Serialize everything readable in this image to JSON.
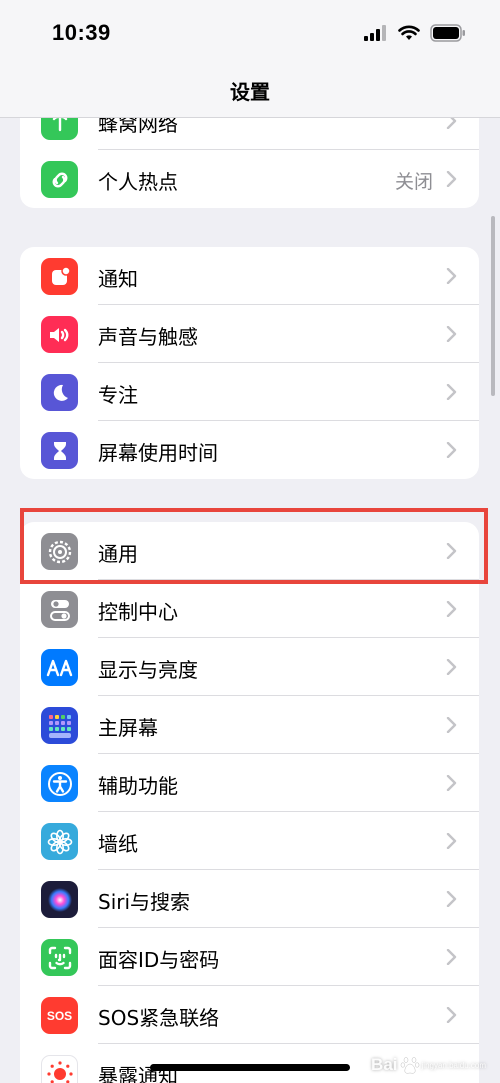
{
  "status_bar": {
    "time": "10:39"
  },
  "nav": {
    "title": "设置"
  },
  "groups": [
    {
      "items": [
        {
          "label": "蜂窝网络",
          "icon": "cellular-icon",
          "color": "#34c759"
        },
        {
          "label": "个人热点",
          "value": "关闭",
          "icon": "hotspot-icon",
          "color": "#34c759"
        }
      ]
    },
    {
      "items": [
        {
          "label": "通知",
          "icon": "notifications-icon",
          "color": "#ff3b30"
        },
        {
          "label": "声音与触感",
          "icon": "sounds-icon",
          "color": "#ff2d55"
        },
        {
          "label": "专注",
          "icon": "focus-moon-icon",
          "color": "#5856d6"
        },
        {
          "label": "屏幕使用时间",
          "icon": "hourglass-icon",
          "color": "#5856d6"
        }
      ]
    },
    {
      "items": [
        {
          "label": "通用",
          "icon": "gear-icon",
          "color": "#8e8e93"
        },
        {
          "label": "控制中心",
          "icon": "toggles-icon",
          "color": "#8e8e93"
        },
        {
          "label": "显示与亮度",
          "icon": "display-aa-icon",
          "color": "#007aff"
        },
        {
          "label": "主屏幕",
          "icon": "home-screen-grid-icon",
          "color": "#2c4bd9"
        },
        {
          "label": "辅助功能",
          "icon": "accessibility-icon",
          "color": "#0a84ff"
        },
        {
          "label": "墙纸",
          "icon": "wallpaper-flower-icon",
          "color": "#36aadc"
        },
        {
          "label": "Siri与搜索",
          "icon": "siri-icon",
          "color": "#1c1c3a"
        },
        {
          "label": "面容ID与密码",
          "icon": "face-id-icon",
          "color": "#34c759"
        },
        {
          "label": "SOS紧急联络",
          "icon": "sos-icon",
          "color": "#ff3b30",
          "icon_text": "SOS"
        },
        {
          "label": "暴露通知",
          "icon": "exposure-icon",
          "color": "#ffffff"
        }
      ]
    }
  ],
  "highlight": {
    "target": "通用",
    "color": "#e8453c"
  },
  "watermark": {
    "text": "Bai",
    "sub": "jingyan.baidu.com"
  }
}
